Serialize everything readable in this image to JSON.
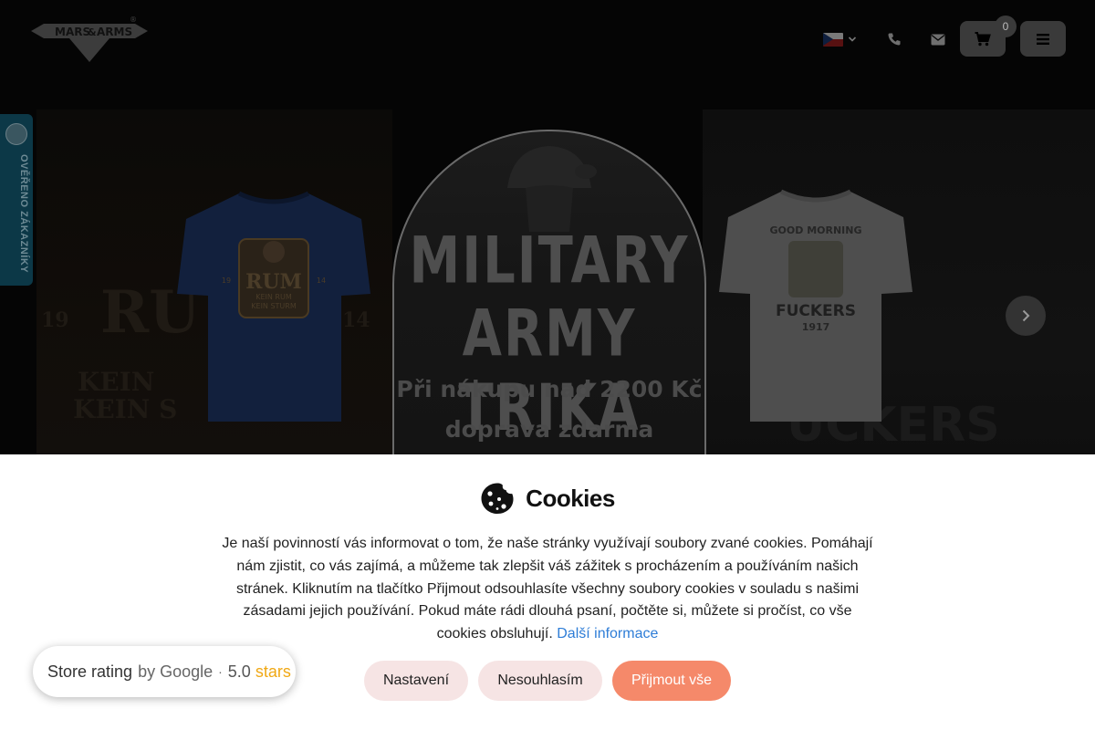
{
  "header": {
    "logo_text_1": "MARS",
    "logo_text_2": "&",
    "logo_text_3": "ARMS",
    "logo_registered": "®",
    "language": "CZ",
    "cart_count": "0"
  },
  "banner": {
    "left_bg_letters": "RU",
    "left_year_1": "19",
    "left_year_2": "14",
    "left_tagline_1": "KEIN",
    "left_tagline_2": "KEIN S",
    "left_tee_title": "RUM",
    "left_tee_year_1": "19",
    "left_tee_year_2": "14",
    "left_tee_sub_1": "KEIN RUM",
    "left_tee_sub_2": "KEIN STURM",
    "title_1": "MILITARY",
    "title_2": "ARMY TRIKA",
    "subtitle_1": "Při nákupu nad 2200 Kč",
    "subtitle_2": "doprava zdarma",
    "right_tee_top": "GOOD MORNING",
    "right_tee_main": "FUCKERS",
    "right_tee_year": "1917",
    "right_bg_word": "UCKERS"
  },
  "verified": {
    "label": "OVĚŘENO ZÁKAZNÍKY"
  },
  "cookie": {
    "title": "Cookies",
    "text": "Je naší povinností vás informovat o tom, že naše stránky využívají soubory zvané cookies. Pomáhají nám zjistit, co vás zajímá, a můžeme tak zlepšit váš zážitek s procházením a používáním našich stránek. Kliknutím na tlačítko Přijmout odsouhlasíte všechny soubory cookies v souladu s našimi zásadami jejich používání. Pokud máte rádi dlouhá psaní, počtěte si, můžete si pročíst, co vše cookies obsluhují.",
    "link": "Další informace",
    "btn_settings": "Nastavení",
    "btn_decline": "Nesouhlasím",
    "btn_accept": "Přijmout vše"
  },
  "rating": {
    "label": "Store rating",
    "by": "by Google",
    "dot": "·",
    "score": "5.0",
    "stars": "stars"
  },
  "colors": {
    "accept": "#f5896a",
    "secondary_btn": "#f6e4e4",
    "link": "#2e7dd7",
    "verified_tab": "#0c3847"
  }
}
